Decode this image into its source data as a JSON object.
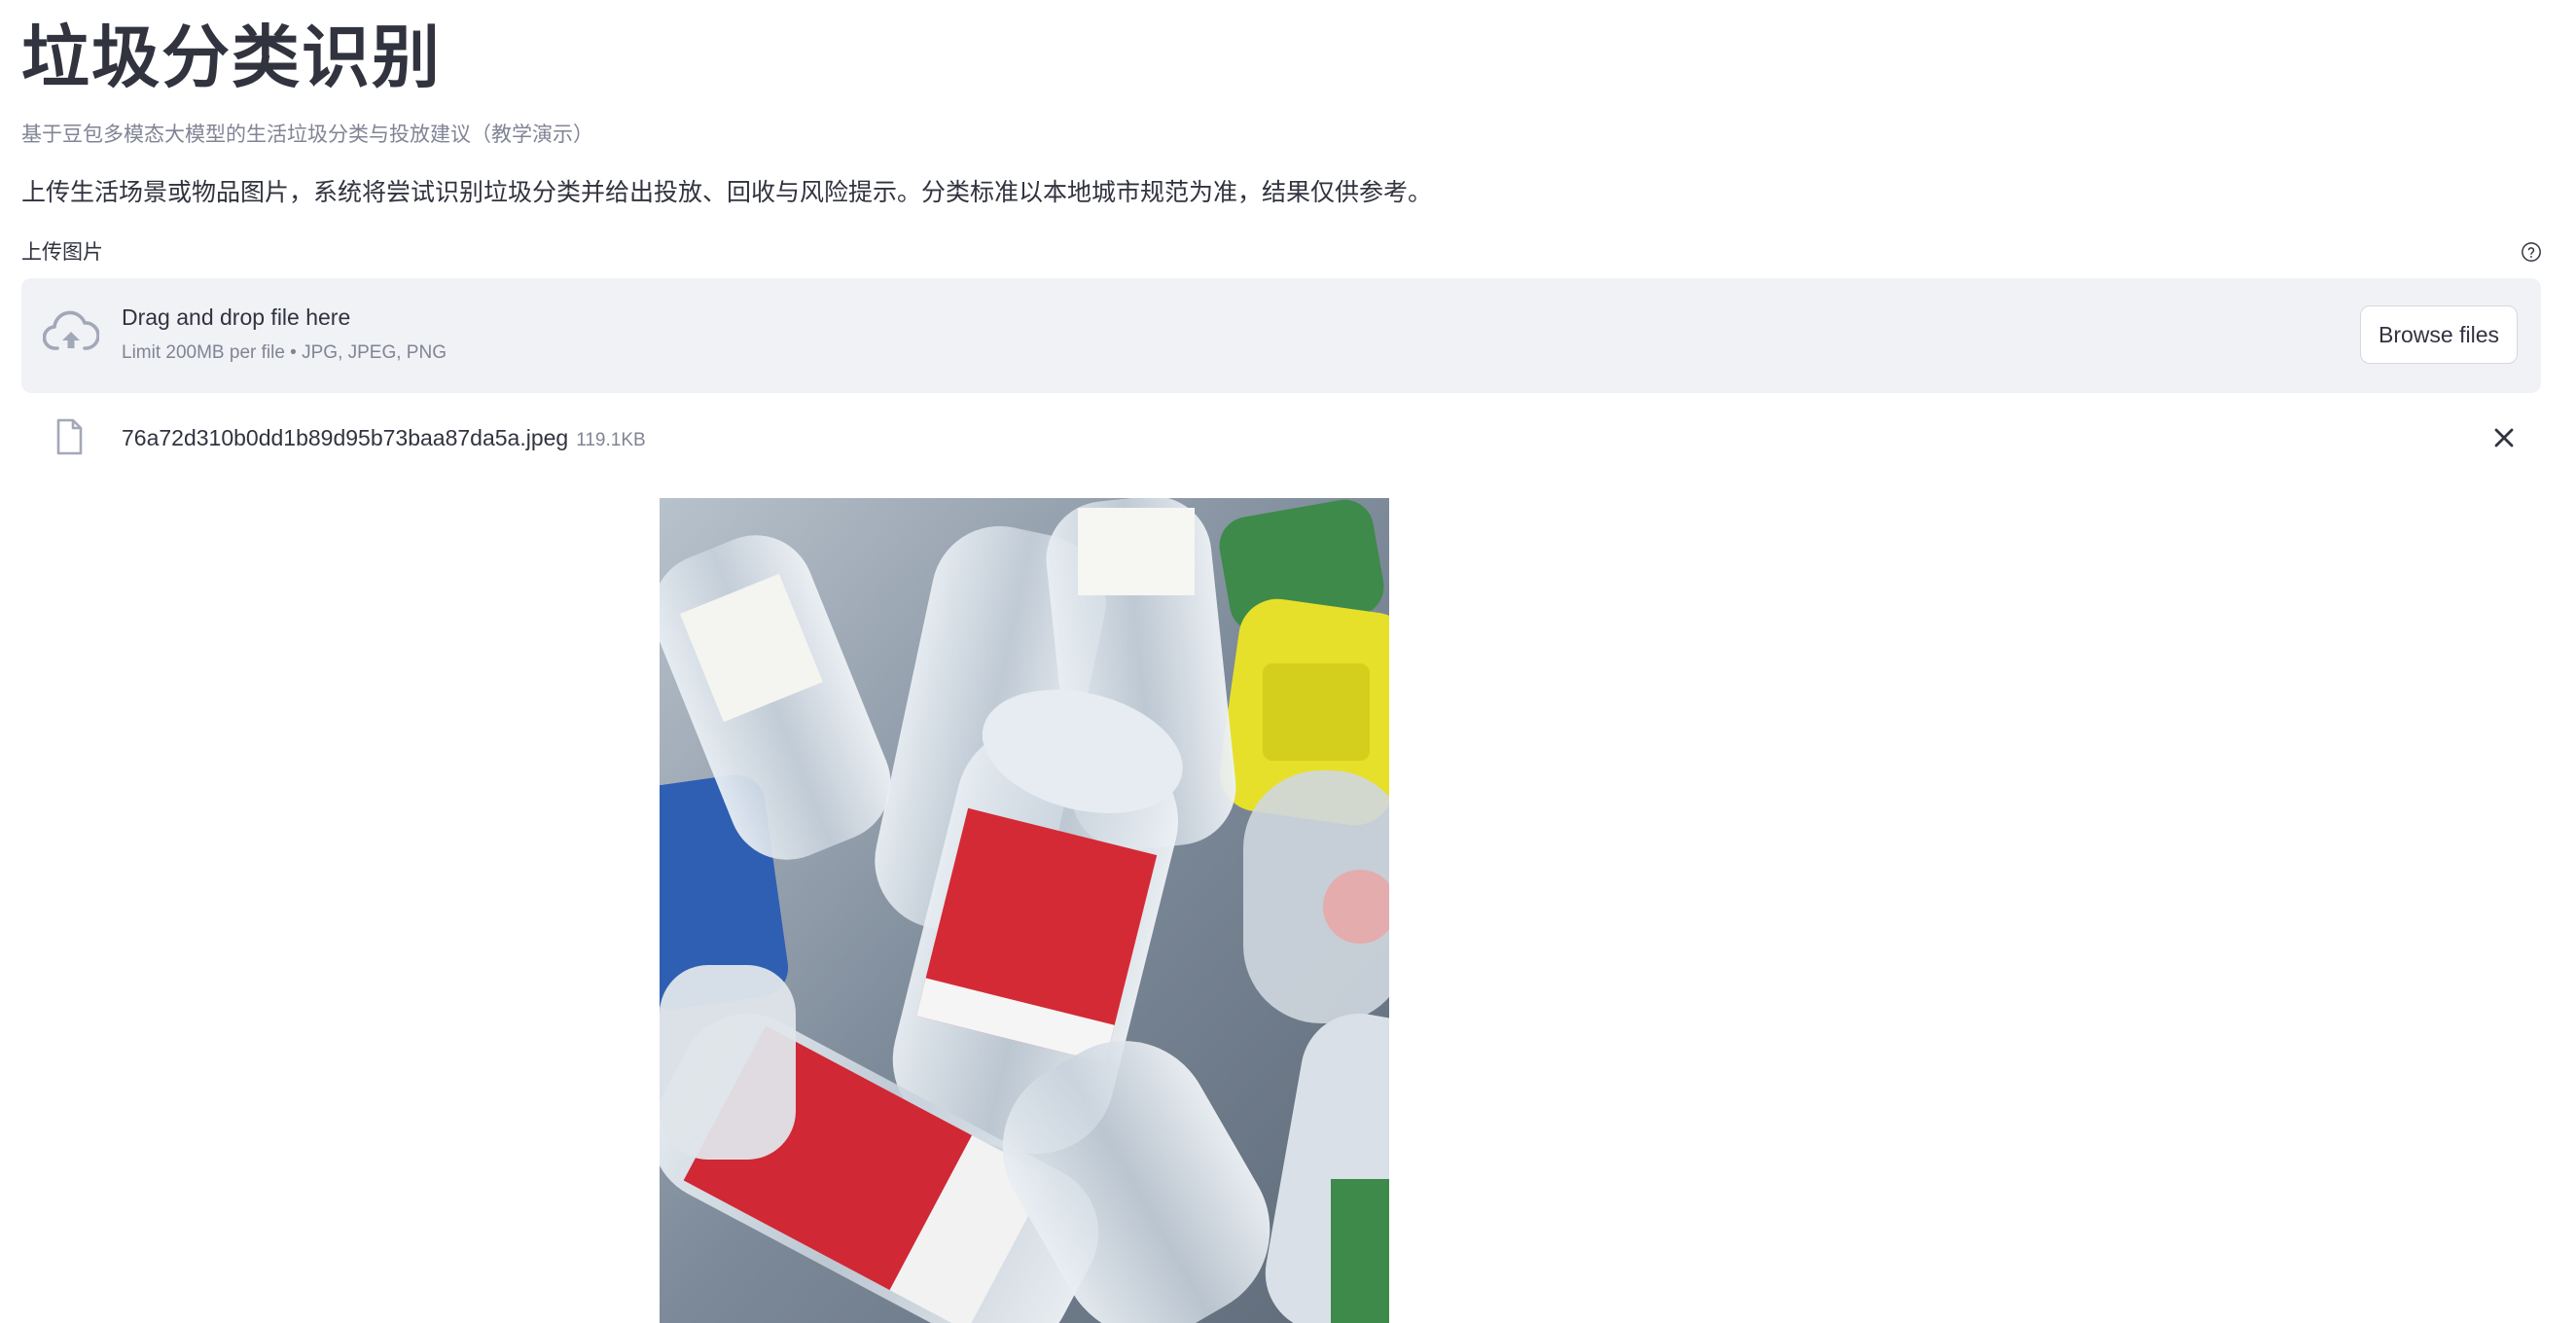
{
  "header": {
    "title": "垃圾分类识别",
    "subtitle": "基于豆包多模态大模型的生活垃圾分类与投放建议（教学演示）",
    "intro": "上传生活场景或物品图片，系统将尝试识别垃圾分类并给出投放、回收与风险提示。分类标准以本地城市规范为准，结果仅供参考。"
  },
  "uploader": {
    "label": "上传图片",
    "help_icon": "question-circle-icon",
    "drop_title": "Drag and drop file here",
    "drop_limit": "Limit 200MB per file • JPG, JPEG, PNG",
    "browse_label": "Browse files",
    "upload_icon": "cloud-upload-icon"
  },
  "uploaded_file": {
    "name": "76a72d310b0dd1b89d95b73baa87da5a.jpeg",
    "size": "119.1KB",
    "file_icon": "document-icon",
    "remove_icon": "close-icon"
  },
  "preview": {
    "icon": "photo-plastic-bottles"
  },
  "colors": {
    "text": "#31333f",
    "muted": "#808495",
    "dropzone_bg": "#f0f2f6",
    "icon": "#a3a8b8"
  }
}
